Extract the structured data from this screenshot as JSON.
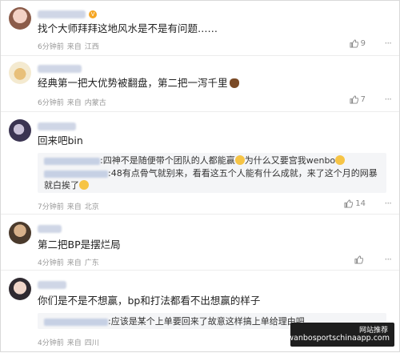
{
  "comments": [
    {
      "text": "找个大师拜拜这地风水是不是有问题……",
      "time": "6分钟前",
      "source": "来自",
      "location": "江西",
      "likes": "9",
      "more": "···",
      "has_vbadge": true
    },
    {
      "text": "经典第一把大优势被翻盘，第二把一泻千里",
      "time": "6分钟前",
      "source": "来自",
      "location": "内蒙古",
      "likes": "7",
      "more": "···"
    },
    {
      "text": "回来吧bin",
      "time": "7分钟前",
      "source": "来自",
      "location": "北京",
      "likes": "14",
      "more": "···",
      "reply": {
        "line1_a": ":四神不是随便带个团队的人都能赢",
        "line1_b": "为什么又要宫我wenbo",
        "line2": ":48有点骨气就别来，看看这五个人能有什么成就，来了这个月的网暴",
        "line3": "就白挨了"
      }
    },
    {
      "text": "第二把BP是摆烂局",
      "time": "4分钟前",
      "source": "来自",
      "location": "广东",
      "likes": "",
      "more": "···"
    },
    {
      "text": "你们是不是不想赢，bp和打法都看不出想赢的样子",
      "time": "4分钟前",
      "source": "来自",
      "location": "四川",
      "likes": "",
      "more": "···",
      "reply": {
        "line1": ":应该是某个上单要回来了故意这样搞上单给理由吧"
      }
    }
  ],
  "watermark": {
    "line1": "网站推荐",
    "line2": "wanbosportschinaapp.com"
  },
  "colors": {
    "meta": "#999999",
    "reply_bg": "#f4f5f7",
    "vbadge": "#f5a623"
  }
}
